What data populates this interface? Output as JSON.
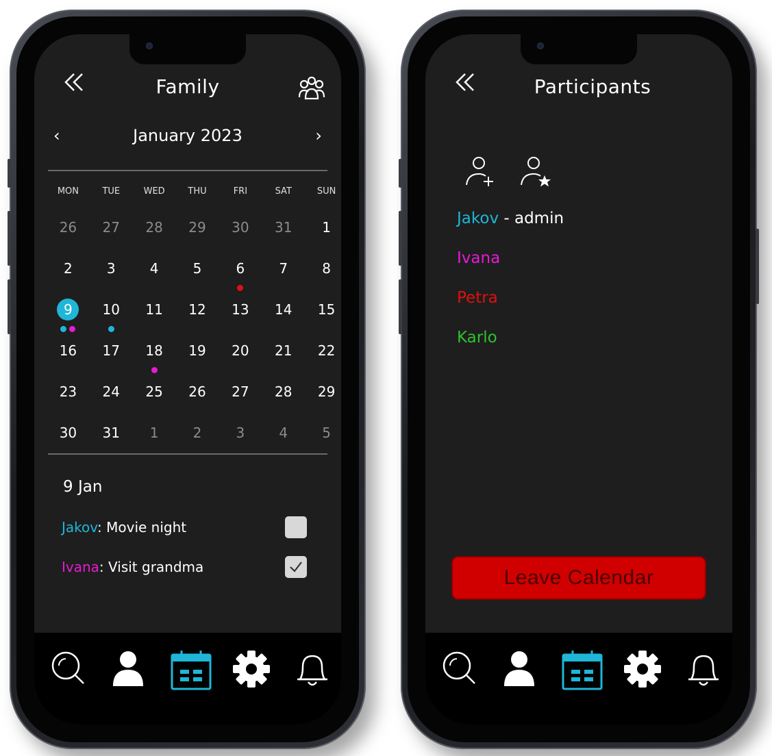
{
  "left": {
    "title": "Family",
    "back_label": "«",
    "month_label": "January 2023",
    "prev_label": "‹",
    "next_label": "›",
    "weekdays": [
      "MON",
      "TUE",
      "WED",
      "THU",
      "FRI",
      "SAT",
      "SUN"
    ],
    "weeks": [
      [
        {
          "d": "26",
          "m": true
        },
        {
          "d": "27",
          "m": true
        },
        {
          "d": "28",
          "m": true
        },
        {
          "d": "29",
          "m": true
        },
        {
          "d": "30",
          "m": true
        },
        {
          "d": "31",
          "m": true
        },
        {
          "d": "1"
        }
      ],
      [
        {
          "d": "2"
        },
        {
          "d": "3"
        },
        {
          "d": "4"
        },
        {
          "d": "5"
        },
        {
          "d": "6",
          "dots": [
            "#e01010"
          ]
        },
        {
          "d": "7"
        },
        {
          "d": "8"
        }
      ],
      [
        {
          "d": "9",
          "sel": true,
          "dots": [
            "#1fb6d8",
            "#e81ad6"
          ]
        },
        {
          "d": "10",
          "dots": [
            "#1fb6d8"
          ]
        },
        {
          "d": "11"
        },
        {
          "d": "12"
        },
        {
          "d": "13"
        },
        {
          "d": "14"
        },
        {
          "d": "15"
        }
      ],
      [
        {
          "d": "16"
        },
        {
          "d": "17"
        },
        {
          "d": "18",
          "dots": [
            "#e81ad6"
          ]
        },
        {
          "d": "19"
        },
        {
          "d": "20"
        },
        {
          "d": "21"
        },
        {
          "d": "22"
        }
      ],
      [
        {
          "d": "23"
        },
        {
          "d": "24"
        },
        {
          "d": "25"
        },
        {
          "d": "26"
        },
        {
          "d": "27"
        },
        {
          "d": "28"
        },
        {
          "d": "29"
        }
      ],
      [
        {
          "d": "30"
        },
        {
          "d": "31"
        },
        {
          "d": "1",
          "m": true
        },
        {
          "d": "2",
          "m": true
        },
        {
          "d": "3",
          "m": true
        },
        {
          "d": "4",
          "m": true
        },
        {
          "d": "5",
          "m": true
        }
      ]
    ],
    "selected_day_label": "9 Jan",
    "events": [
      {
        "person": "Jakov",
        "color": "#1fb6d8",
        "sep": ": ",
        "title": "Movie night",
        "checked": false
      },
      {
        "person": "Ivana",
        "color": "#e81ad6",
        "sep": ": ",
        "title": "Visit grandma",
        "checked": true
      }
    ]
  },
  "right": {
    "title": "Participants",
    "back_label": "«",
    "participants": [
      {
        "name": "Jakov",
        "color": "#1fb6d8",
        "role": " - admin"
      },
      {
        "name": "Ivana",
        "color": "#e81ad6",
        "role": ""
      },
      {
        "name": "Petra",
        "color": "#e01010",
        "role": ""
      },
      {
        "name": "Karlo",
        "color": "#2fc22f",
        "role": ""
      }
    ],
    "leave_label": "Leave Calendar"
  },
  "colors": {
    "accent": "#1fb6d8",
    "danger": "#d00000",
    "screen_bg": "#1e1e1e",
    "tabbar_bg": "#000000"
  },
  "tabs": [
    "search-icon",
    "profile-icon",
    "calendar-icon",
    "settings-icon",
    "bell-icon"
  ],
  "active_tab": "calendar-icon"
}
